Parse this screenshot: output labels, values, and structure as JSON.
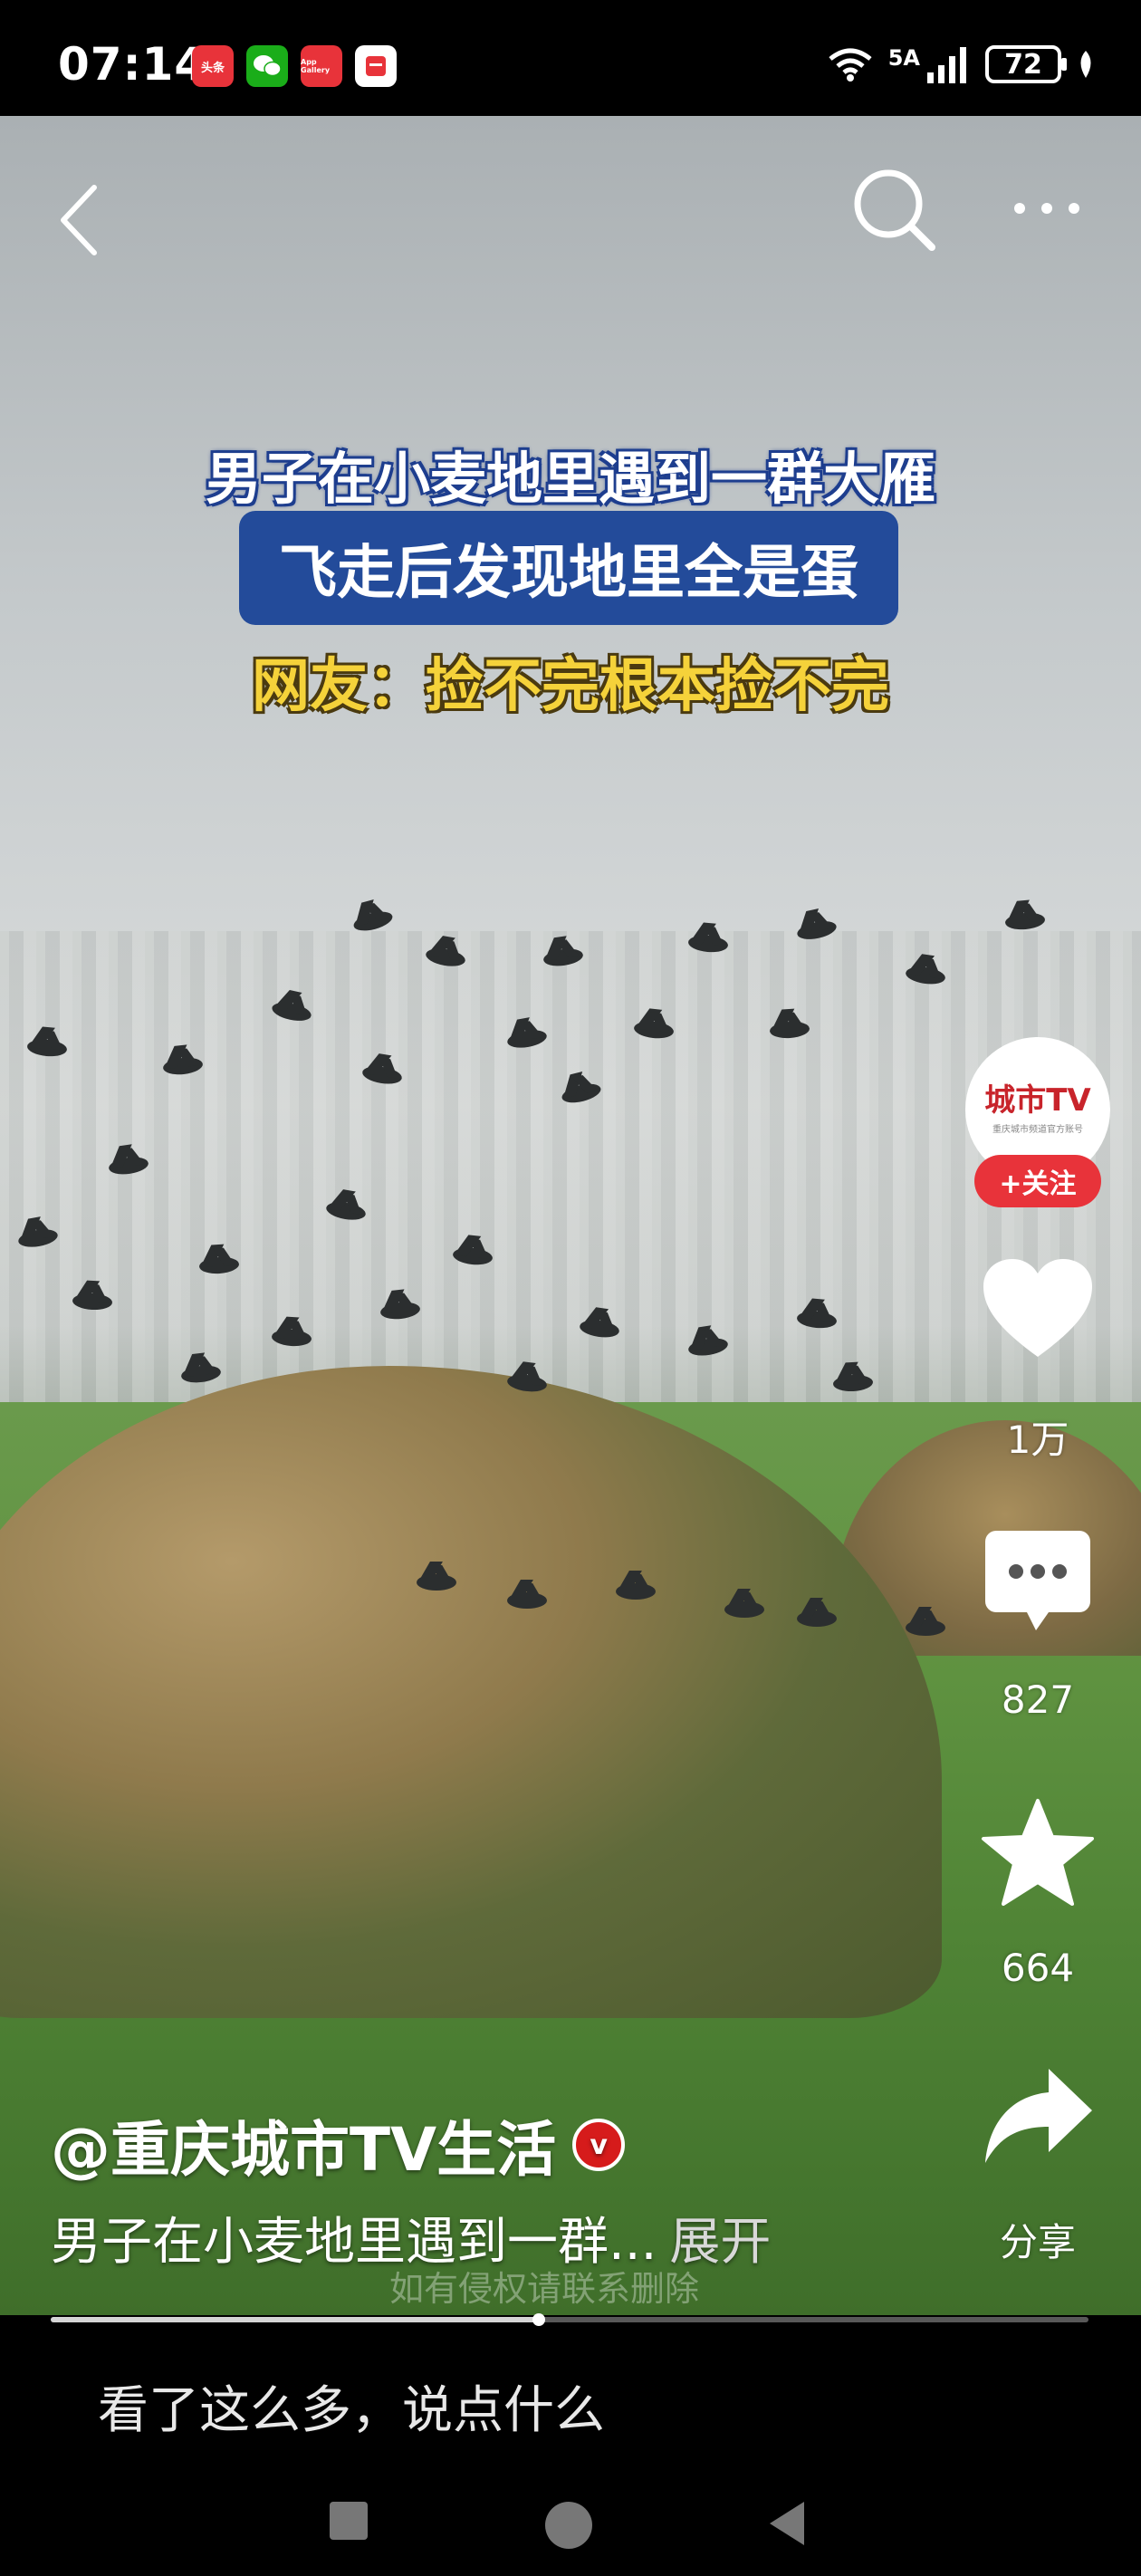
{
  "status_bar": {
    "time": "07:14",
    "apps": [
      {
        "icon": "toutiao-icon",
        "label": "头条",
        "color": "#e8333a"
      },
      {
        "icon": "wechat-icon",
        "label": "",
        "color": "#1aad19"
      },
      {
        "icon": "app-gallery-icon",
        "label": "App Gallery",
        "color": "#e8333a"
      },
      {
        "icon": "notes-icon",
        "label": "",
        "color": "#ffffff"
      }
    ],
    "network": "5A",
    "battery": "72"
  },
  "video": {
    "caption_line1": "男子在小麦地里遇到一群大雁",
    "caption_line2": "飞走后发现地里全是蛋",
    "caption_line3": "网友：捡不完根本捡不完",
    "watermark": "如有侵权请联系删除",
    "progress": 0.47
  },
  "channel": {
    "avatar_logo": "城市TV",
    "avatar_sub": "重庆城市频道官方账号",
    "follow_label": "+关注"
  },
  "actions": {
    "likes": "1万",
    "comments": "827",
    "favorites": "664",
    "share_label": "分享"
  },
  "post": {
    "author": "@重庆城市TV生活",
    "verified_mark": "v",
    "description": "男子在小麦地里遇到一群...",
    "expand_label": "展开"
  },
  "comment_bar": {
    "placeholder": "看了这么多，说点什么"
  },
  "colors": {
    "accent_red": "#e8333a",
    "caption_blue": "#234b9a",
    "caption_yellow": "#f5d23a"
  }
}
